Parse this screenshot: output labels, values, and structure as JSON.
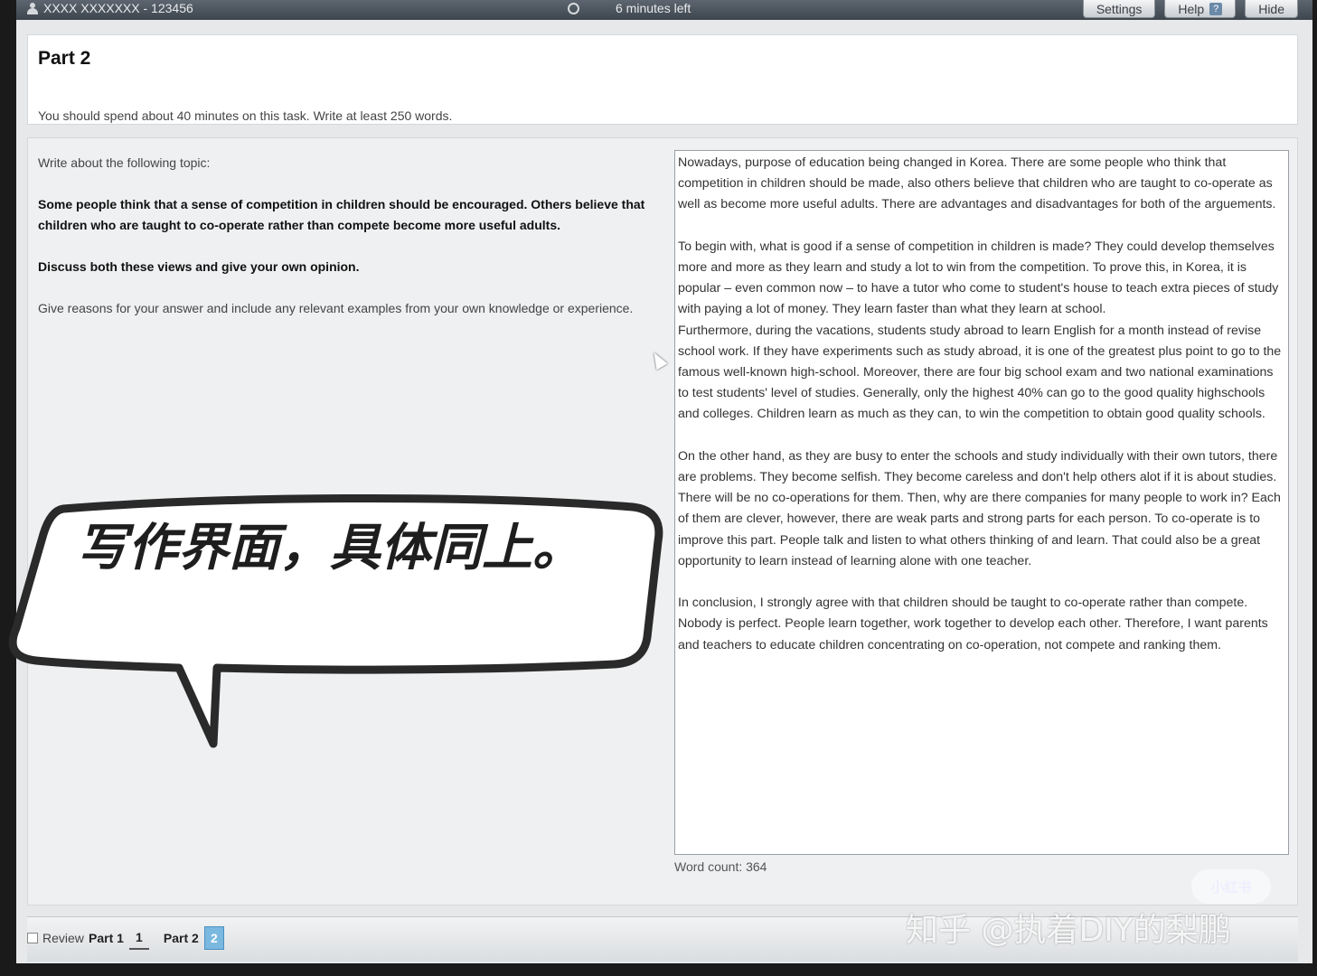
{
  "topbar": {
    "candidate": "XXXX XXXXXXX - 123456",
    "timer": "6 minutes left",
    "settings_label": "Settings",
    "help_label": "Help",
    "help_icon": "?",
    "hide_label": "Hide"
  },
  "header": {
    "title": "Part 2",
    "instructions": "You should spend about 40 minutes on this task. Write at least 250 words."
  },
  "prompt": {
    "intro": "Write about the following topic:",
    "statement": "Some people think that a sense of competition in children should be encouraged. Others believe that children who are taught to co-operate rather than compete become more useful adults.",
    "task": "Discuss both these views and give your own opinion.",
    "guidance": "Give reasons for your answer and include any relevant examples from your own knowledge or experience."
  },
  "essay": {
    "text": "Nowadays, purpose of education being changed in Korea. There are some people who think that competition in children should be made, also others believe that children who are taught to co-operate as well as become more useful adults. There are advantages and disadvantages for both of the arguements.\n\nTo begin with, what is good if a sense of competition in children is made? They could develop themselves more and more as they learn and study a lot to win from the competition. To prove this, in Korea, it is popular – even common now – to have a tutor who come to student's house to teach extra pieces of study with paying a lot of money. They learn faster than what they learn at school.\nFurthermore, during the vacations, students study abroad to learn English for a month instead of revise school work. If they have experiments such as study abroad, it is one of the greatest plus point to go to the famous well-known high-school. Moreover, there are four big school exam and two national examinations to test students' level of studies. Generally, only the highest 40% can go to the good quality highschools and colleges. Children learn as much as they can, to win the competition to obtain good quality schools.\n\nOn the other hand, as they are busy to enter the schools and study individually with their own tutors, there are problems. They become selfish. They become careless and don't help others alot if it is about studies. There will be no co-operations for them. Then, why are there companies for many people to work in? Each of them are clever, however, there are weak parts and strong parts for each person. To co-operate is to improve this part. People talk and listen to what others thinking of and learn. That could also be a great opportunity to learn instead of learning alone with one teacher.\n\nIn conclusion, I strongly agree with that children should be taught to co-operate rather than compete. Nobody is perfect. People learn together, work together to develop each other. Therefore, I want parents and teachers to educate children concentrating on co-operation, not compete and ranking them.",
    "word_count": "Word count: 364"
  },
  "overlay": {
    "bubble_text": "写作界面，具体同上。"
  },
  "bottombar": {
    "review_label": "Review",
    "parts": [
      {
        "label": "Part 1",
        "number": "1"
      },
      {
        "label": "Part 2",
        "number": "2"
      }
    ]
  },
  "watermarks": {
    "badge": "小红书",
    "credit": "知乎 @执着DIY的梨鹏"
  }
}
